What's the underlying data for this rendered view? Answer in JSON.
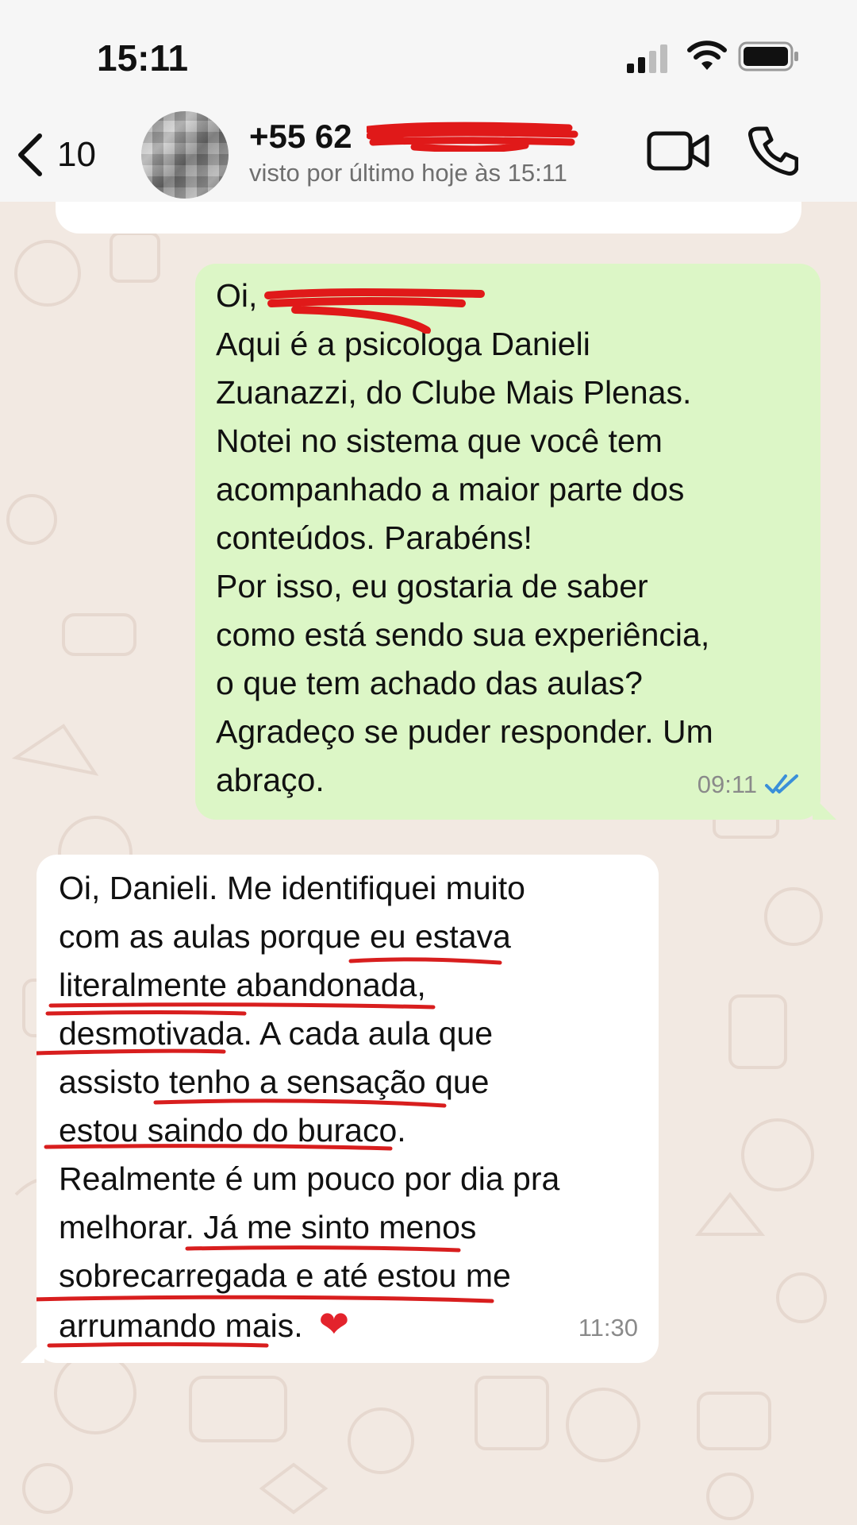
{
  "status_bar": {
    "time": "15:11"
  },
  "header": {
    "back_count": "10",
    "contact_name": "+55 62",
    "contact_status": "visto por último hoje às 15:11"
  },
  "messages": {
    "outgoing": {
      "greeting": "Oi,",
      "lines": [
        "Aqui é a psicologa Danieli",
        "Zuanazzi, do Clube Mais Plenas.",
        "Notei no sistema que você tem",
        "acompanhado a maior parte dos",
        "conteúdos. Parabéns!",
        "Por isso, eu gostaria de saber",
        "como está sendo sua experiência,",
        "o que tem achado das aulas?",
        "Agradeço se puder responder. Um",
        "abraço."
      ],
      "time": "09:11",
      "status_icon": "double-check-read-icon"
    },
    "incoming": {
      "lines": [
        "Oi, Danieli. Me identifiquei muito",
        "com as aulas porque eu estava",
        "literalmente abandonada,",
        "desmotivada. A cada aula que",
        "assisto tenho a sensação que",
        "estou saindo do buraco.",
        "Realmente é um pouco por dia pra",
        "melhorar.  Já me sinto menos",
        "sobrecarregada e até estou me",
        "arrumando mais."
      ],
      "emoji": "❤",
      "time": "11:30"
    }
  },
  "colors": {
    "outgoing_bubble": "#dcf6c6",
    "incoming_bubble": "#ffffff",
    "read_ticks": "#3a8fd9",
    "annotation_red": "#d81e1e"
  }
}
